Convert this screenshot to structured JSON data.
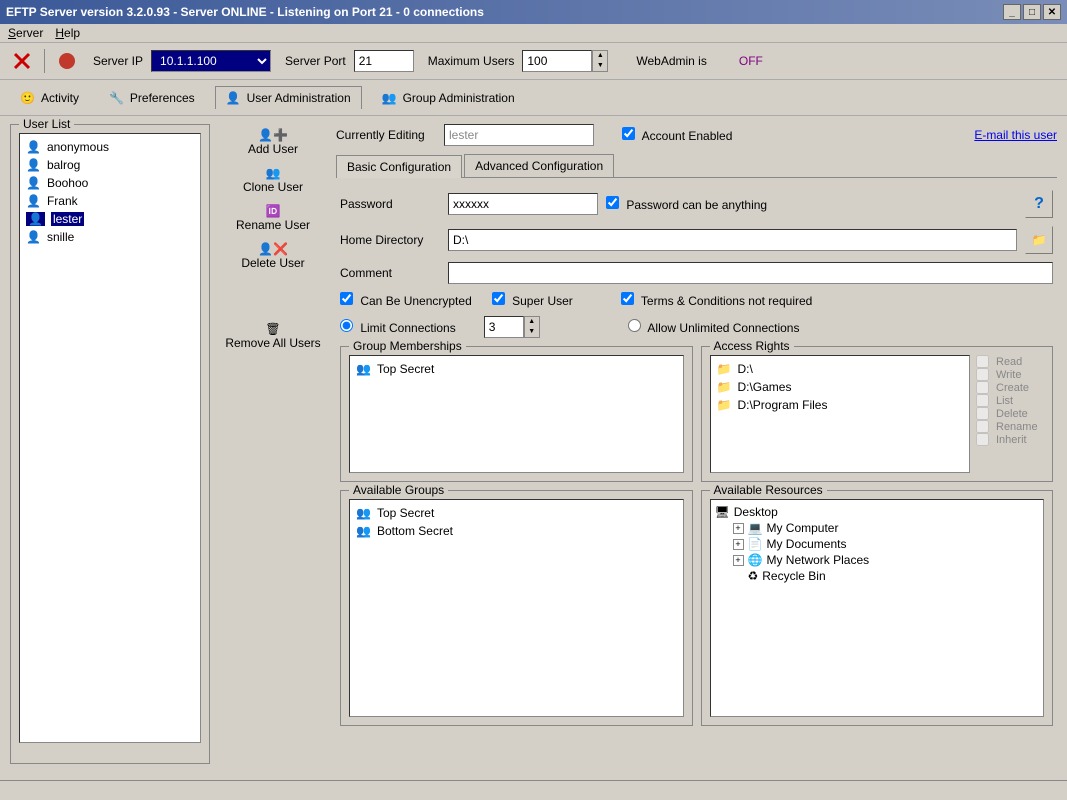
{
  "titlebar": "EFTP Server version 3.2.0.93 - Server ONLINE - Listening on Port 21 - 0 connections",
  "menu": {
    "server": "Server",
    "help": "Help"
  },
  "toolbar": {
    "server_ip_label": "Server IP",
    "server_ip": "10.1.1.100",
    "server_port_label": "Server Port",
    "server_port": "21",
    "max_users_label": "Maximum Users",
    "max_users": "100",
    "webadmin_label": "WebAdmin is",
    "webadmin_status": "OFF"
  },
  "tabs": {
    "activity": "Activity",
    "preferences": "Preferences",
    "user_admin": "User Administration",
    "group_admin": "Group Administration"
  },
  "user_list": {
    "legend": "User List",
    "items": [
      "anonymous",
      "balrog",
      "Boohoo",
      "Frank",
      "lester",
      "snille"
    ],
    "selected": "lester"
  },
  "actions": {
    "add_user": "Add User",
    "clone_user": "Clone User",
    "rename_user": "Rename User",
    "delete_user": "Delete User",
    "remove_all": "Remove All Users"
  },
  "edit": {
    "currently_editing": "Currently Editing",
    "editing_value": "lester",
    "account_enabled": "Account Enabled",
    "email_link": "E-mail this user",
    "basic_tab": "Basic Configuration",
    "advanced_tab": "Advanced Configuration",
    "password_label": "Password",
    "password_value": "xxxxxx",
    "password_anything": "Password can be anything",
    "home_dir_label": "Home Directory",
    "home_dir_value": "D:\\",
    "comment_label": "Comment",
    "comment_value": "",
    "can_unencrypted": "Can Be Unencrypted",
    "super_user": "Super User",
    "terms_not_req": "Terms & Conditions not required",
    "limit_conn": "Limit Connections",
    "limit_conn_value": "3",
    "allow_unlimited": "Allow Unlimited Connections"
  },
  "group_memberships": {
    "legend": "Group Memberships",
    "items": [
      "Top Secret"
    ]
  },
  "access_rights": {
    "legend": "Access Rights",
    "paths": [
      "D:\\",
      "D:\\Games",
      "D:\\Program Files"
    ],
    "rights": [
      "Read",
      "Write",
      "Create",
      "List",
      "Delete",
      "Rename",
      "Inherit"
    ]
  },
  "available_groups": {
    "legend": "Available Groups",
    "items": [
      "Top Secret",
      "Bottom Secret"
    ]
  },
  "available_resources": {
    "legend": "Available Resources",
    "root": "Desktop",
    "children": [
      "My Computer",
      "My Documents",
      "My Network Places",
      "Recycle Bin"
    ]
  }
}
